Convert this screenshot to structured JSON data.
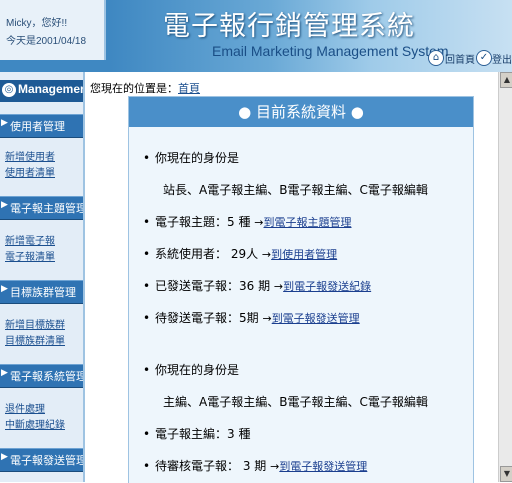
{
  "header": {
    "user_greeting": "Micky，您好!!",
    "date_text": "今天是2001/04/18",
    "system_title": "電子報行銷管理系統",
    "system_subtitle": "Email Marketing Management System",
    "home_label": "回首頁",
    "logout_label": "登出",
    "accent_color": "#3f88c2"
  },
  "sidebar": {
    "title": "Management",
    "groups": [
      {
        "label": "使用者管理",
        "links": [
          "新增使用者",
          "使用者清單"
        ]
      },
      {
        "label": "電子報主題管理",
        "links": [
          "新增電子報",
          "電子報清單"
        ]
      },
      {
        "label": "目標族群管理",
        "links": [
          "新增目標族群",
          "目標族群清單"
        ]
      },
      {
        "label": "電子報系統管理",
        "links": [
          "退件處理",
          "中斷處理紀錄"
        ]
      },
      {
        "label": "電子報發送管理",
        "links": []
      }
    ]
  },
  "breadcrumb": {
    "prefix": "您現在的位置是：",
    "current": "首頁"
  },
  "panel": {
    "title": "● 目前系統資料 ●",
    "section1": {
      "identity_label": "你現在的身份是",
      "identity_value": "站長、A電子報主編、B電子報主編、C電子報編輯",
      "topics_text": "電子報主題：5 種",
      "topics_link": "到電子報主題管理",
      "users_text": "系統使用者： 29人",
      "users_link": "到使用者管理",
      "sent_text": "已發送電子報：36 期",
      "sent_link": "到電子報發送紀錄",
      "pending_text": "待發送電子報：5期",
      "pending_link": "到電子報發送管理"
    },
    "section2": {
      "identity_label": "你現在的身份是",
      "identity_value": "主編、A電子報主編、B電子報主編、C電子報編輯",
      "editor_text": "電子報主編：3 種",
      "review_text": "待審核電子報： 3 期",
      "review_link": "到電子報發送管理"
    }
  },
  "icons": {
    "home": "home-icon",
    "logout": "logout-icon",
    "bullet": "bullet-icon",
    "arrow": "arrow-right-icon"
  }
}
